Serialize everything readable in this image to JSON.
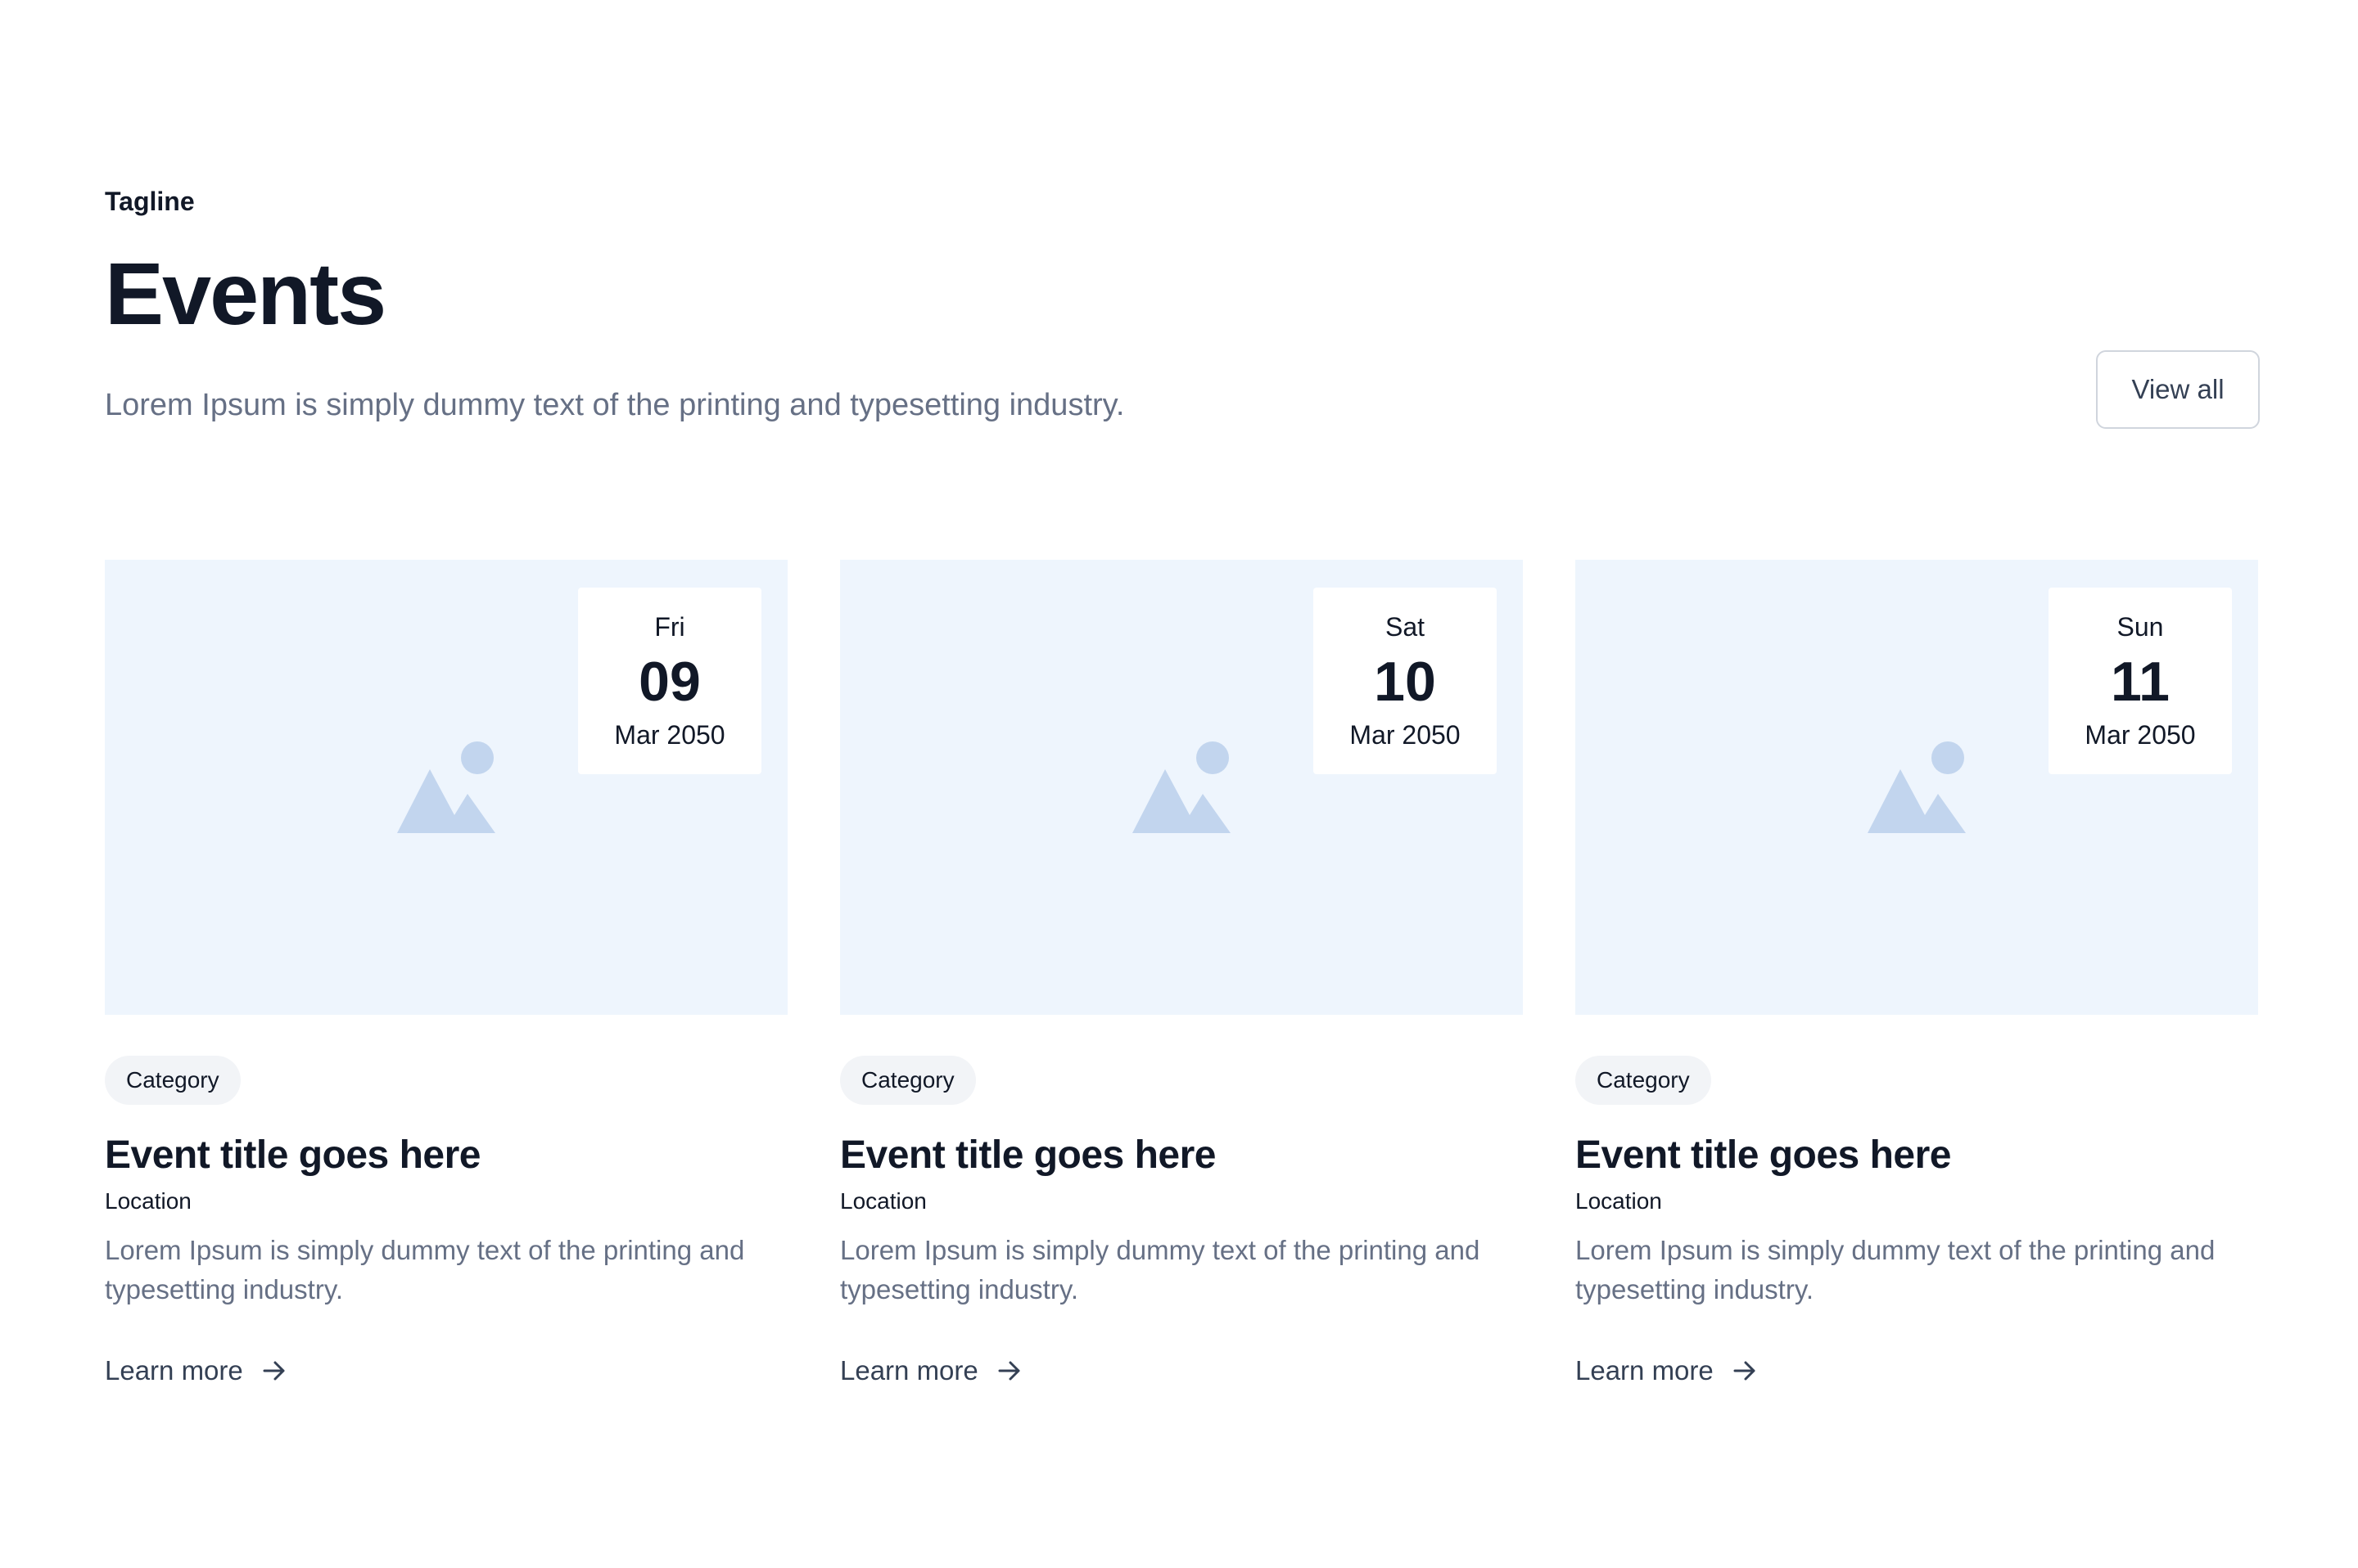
{
  "header": {
    "tagline": "Tagline",
    "title": "Events",
    "subtitle": "Lorem Ipsum is simply dummy text of the printing and typesetting industry.",
    "view_all_label": "View all"
  },
  "cards": [
    {
      "image_icon": "image-placeholder-icon",
      "date": {
        "day": "Fri",
        "number": "09",
        "month": "Mar 2050"
      },
      "category": "Category",
      "title": "Event title goes here",
      "location": "Location",
      "description": "Lorem Ipsum is simply dummy text of the printing and typesetting industry.",
      "link_label": "Learn more",
      "link_icon": "arrow-right-icon"
    },
    {
      "image_icon": "image-placeholder-icon",
      "date": {
        "day": "Sat",
        "number": "10",
        "month": "Mar 2050"
      },
      "category": "Category",
      "title": "Event title goes here",
      "location": "Location",
      "description": "Lorem Ipsum is simply dummy text of the printing and typesetting industry.",
      "link_label": "Learn more",
      "link_icon": "arrow-right-icon"
    },
    {
      "image_icon": "image-placeholder-icon",
      "date": {
        "day": "Sun",
        "number": "11",
        "month": "Mar 2050"
      },
      "category": "Category",
      "title": "Event title goes here",
      "location": "Location",
      "description": "Lorem Ipsum is simply dummy text of the printing and typesetting industry.",
      "link_label": "Learn more",
      "link_icon": "arrow-right-icon"
    }
  ],
  "colors": {
    "heading": "#111827",
    "muted_text": "#667085",
    "media_background": "#eef5fd",
    "placeholder_icon": "#c2d5ee",
    "category_pill": "#f2f4f7",
    "button_border": "#d0d5dd"
  }
}
